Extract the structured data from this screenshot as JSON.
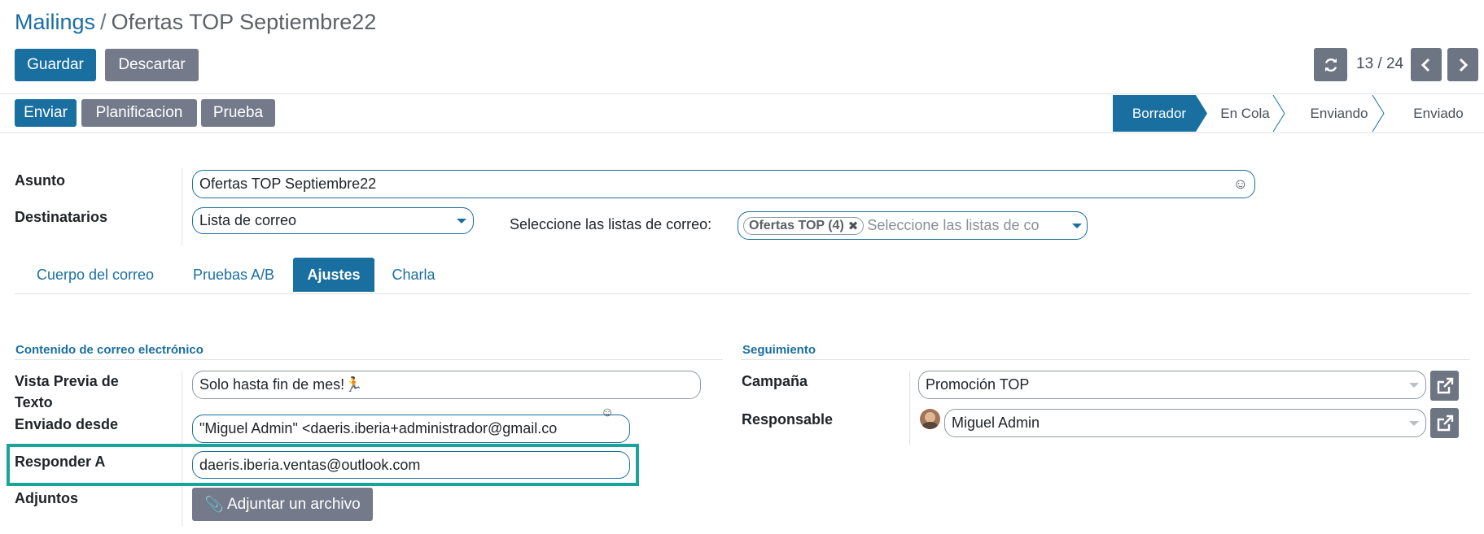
{
  "breadcrumb": {
    "parent": "Mailings",
    "separator": "/",
    "current": "Ofertas TOP Septiembre22"
  },
  "toolbar": {
    "save_label": "Guardar",
    "discard_label": "Descartar"
  },
  "pager": {
    "value": "13 / 24"
  },
  "actions": {
    "send": "Enviar",
    "schedule": "Planificacion",
    "test": "Prueba"
  },
  "stages": [
    {
      "label": "Borrador",
      "active": true
    },
    {
      "label": "En Cola",
      "active": false
    },
    {
      "label": "Enviando",
      "active": false
    },
    {
      "label": "Enviado",
      "active": false
    }
  ],
  "form": {
    "subject_label": "Asunto",
    "subject_value": "Ofertas TOP Septiembre22",
    "recipients_label": "Destinatarios",
    "recipients_value": "Lista de correo",
    "mailing_lists_label": "Seleccione las listas de correo:",
    "mailing_list_tag": "Ofertas TOP (4)",
    "mailing_lists_placeholder": "Seleccione las listas de co"
  },
  "tabs": [
    "Cuerpo del correo",
    "Pruebas A/B",
    "Ajustes",
    "Charla"
  ],
  "active_tab": "Ajustes",
  "content_section": {
    "title": "Contenido de correo electrónico",
    "preview_label_line1": "Vista Previa de",
    "preview_label_line2": "Texto",
    "preview_value": "Solo hasta fin de mes!🏃",
    "sent_from_label": "Enviado desde",
    "sent_from_value": "\"Miguel Admin\" <daeris.iberia+administrador@gmail.co",
    "reply_to_label": "Responder A",
    "reply_to_value": "daeris.iberia.ventas@outlook.com",
    "attachments_label": "Adjuntos",
    "attach_button": "Adjuntar un archivo"
  },
  "tracking_section": {
    "title": "Seguimiento",
    "campaign_label": "Campaña",
    "campaign_value": "Promoción TOP",
    "responsible_label": "Responsable",
    "responsible_value": "Miguel Admin"
  },
  "colors": {
    "primary": "#1a6fa1",
    "secondary": "#747a8a",
    "highlight": "#1aa39a"
  },
  "icons": {
    "emoji": "smiley-icon",
    "refresh": "refresh-icon",
    "prev": "chevron-left-icon",
    "next": "chevron-right-icon",
    "external": "external-link-icon",
    "paperclip": "paperclip-icon",
    "remove": "close-icon"
  }
}
